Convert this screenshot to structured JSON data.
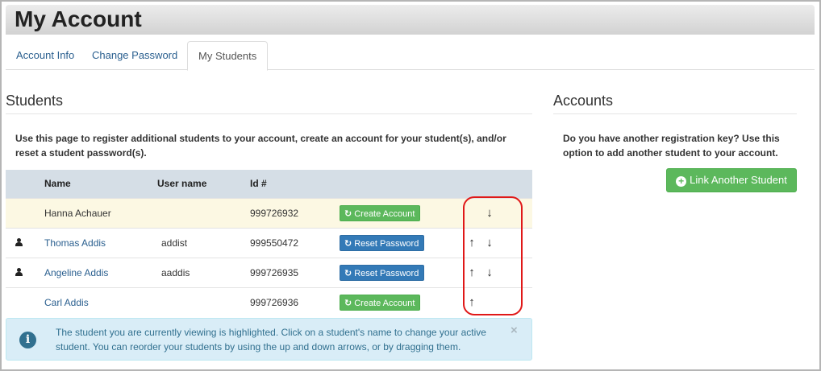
{
  "page": {
    "title": "My Account"
  },
  "tabs": [
    {
      "label": "Account Info",
      "active": false
    },
    {
      "label": "Change Password",
      "active": false
    },
    {
      "label": "My Students",
      "active": true
    }
  ],
  "students": {
    "title": "Students",
    "description": "Use this page to register additional students to your account, create an account for your student(s), and/or reset a student password(s).",
    "columns": [
      "Name",
      "User name",
      "Id #"
    ],
    "rows": [
      {
        "name": "Hanna Achauer",
        "username": "",
        "id": "999726932",
        "action": "Create Account",
        "has_account": false,
        "highlighted": true,
        "up": false,
        "down": true
      },
      {
        "name": "Thomas Addis",
        "username": "addist",
        "id": "999550472",
        "action": "Reset Password",
        "has_account": true,
        "highlighted": false,
        "up": true,
        "down": true
      },
      {
        "name": "Angeline Addis",
        "username": "aaddis",
        "id": "999726935",
        "action": "Reset Password",
        "has_account": true,
        "highlighted": false,
        "up": true,
        "down": true
      },
      {
        "name": "Carl Addis",
        "username": "",
        "id": "999726936",
        "action": "Create Account",
        "has_account": false,
        "highlighted": false,
        "up": true,
        "down": false
      }
    ],
    "arrow_up": "↑",
    "arrow_down": "↓"
  },
  "alert": {
    "text": "The student you are currently viewing is highlighted. Click on a student's name to change your active student. You can reorder your students by using the up and down arrows, or by dragging them.",
    "close": "×"
  },
  "accounts": {
    "title": "Accounts",
    "description": "Do you have another registration key? Use this option to add another student to your account.",
    "button_label": "Link Another Student"
  },
  "colors": {
    "highlight_row": "#fcf8e3",
    "create_button": "#5cb85c",
    "reset_button": "#337ab7",
    "alert_bg": "#d9edf7",
    "annotation_ring": "#e01818"
  },
  "icons": {
    "user": "user-icon",
    "refresh": "refresh-icon",
    "info": "info-icon",
    "plus": "plus-circle-icon"
  }
}
